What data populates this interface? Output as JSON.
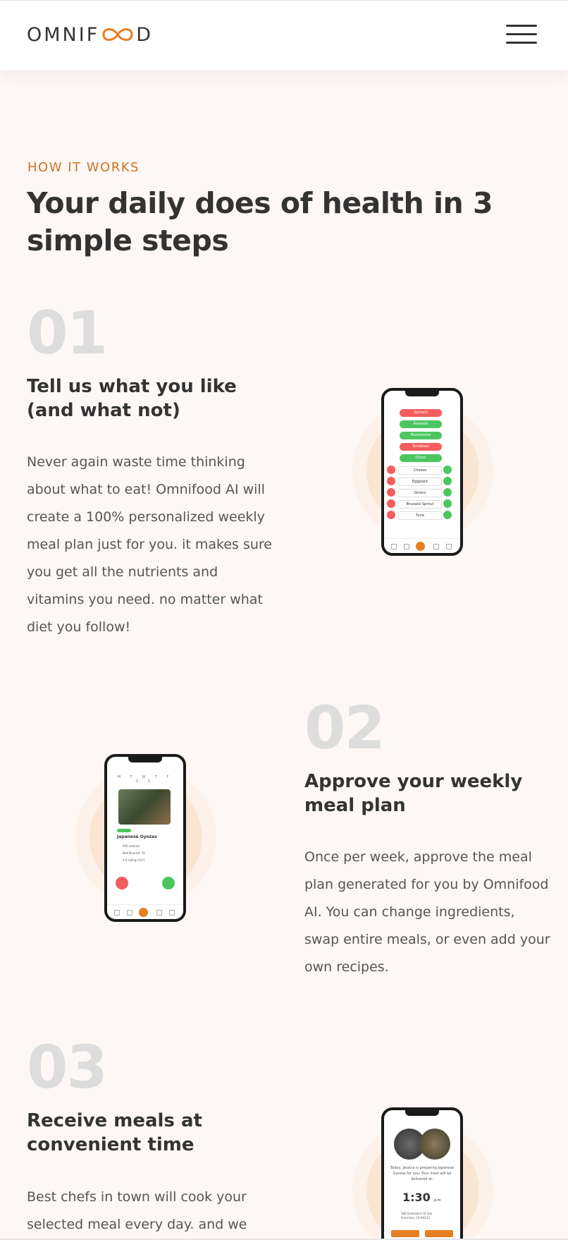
{
  "header": {
    "logo_text_left": "OMNIF",
    "logo_text_right": "D",
    "menu_icon": "hamburger-menu-icon"
  },
  "section": {
    "eyebrow": "HOW IT WORKS",
    "heading": "Your daily does of health in 3 simple steps"
  },
  "steps": [
    {
      "number": "01",
      "title": "Tell us what you like (and what not)",
      "description": "Never again waste time thinking about what to eat! Omnifood AI will create a 100% personalized weekly meal plan just for you. it makes sure you get all the nutrients and vitamins you need. no matter what diet you follow!",
      "phone_pills": [
        {
          "label": "Spinach",
          "color": "red"
        },
        {
          "label": "Avocado",
          "color": "green"
        },
        {
          "label": "Mushrooms",
          "color": "green"
        },
        {
          "label": "Tomatoes",
          "color": "red"
        },
        {
          "label": "Olives",
          "color": "green"
        }
      ],
      "phone_rows": [
        "Cheese",
        "Eggplant",
        "Onions",
        "Brussels Sprout",
        "Tuna"
      ]
    },
    {
      "number": "02",
      "title": "Approve your weekly meal plan",
      "description": "Once per week, approve the meal plan generated for you by Omnifood AI. You can change ingredients, swap entire meals, or even add your own recipes.",
      "phone_meal": "Japanese Gyozas",
      "phone_days": "M T W T F S S",
      "phone_facts": [
        "650 calories",
        "NutriScore® 74",
        "4.9 rating (537)"
      ]
    },
    {
      "number": "03",
      "title": "Receive meals at convenient time",
      "description": "Best chefs in town will cook your selected meal every day. and we",
      "phone_message": "Today, Jessica is preparing Japanese Gyozas for you. Your meal will be delivered at:",
      "phone_time": "1:30",
      "phone_time_suffix": "p.m.",
      "phone_address": "580 Greenwich St San Francisco, CA 94133"
    }
  ],
  "colors": {
    "accent": "#e67e22",
    "eyebrow": "#cf711f",
    "background": "#fdf8f5",
    "step_number": "#dddddd"
  }
}
